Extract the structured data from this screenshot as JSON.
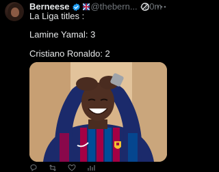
{
  "tweet": {
    "display_name": "Berneese",
    "handle": "@thebern...",
    "time": "20m",
    "lines": [
      "La Liga titles :",
      "Lamine Yamal: 3",
      "Cristiano Ronaldo: 2"
    ],
    "icons": {
      "verified": "verified-badge-icon",
      "flag": "flag-icon",
      "grok": "grok-icon",
      "more": "more-options-icon",
      "reply": "reply-icon",
      "retweet": "retweet-icon",
      "like": "like-icon",
      "views": "views-icon"
    },
    "colors": {
      "background": "#000000",
      "text": "#e7e9ea",
      "muted": "#71767b",
      "verified": "#1d9bf0"
    },
    "media": {
      "jersey_colors": [
        "#a50044",
        "#004d98"
      ]
    }
  }
}
